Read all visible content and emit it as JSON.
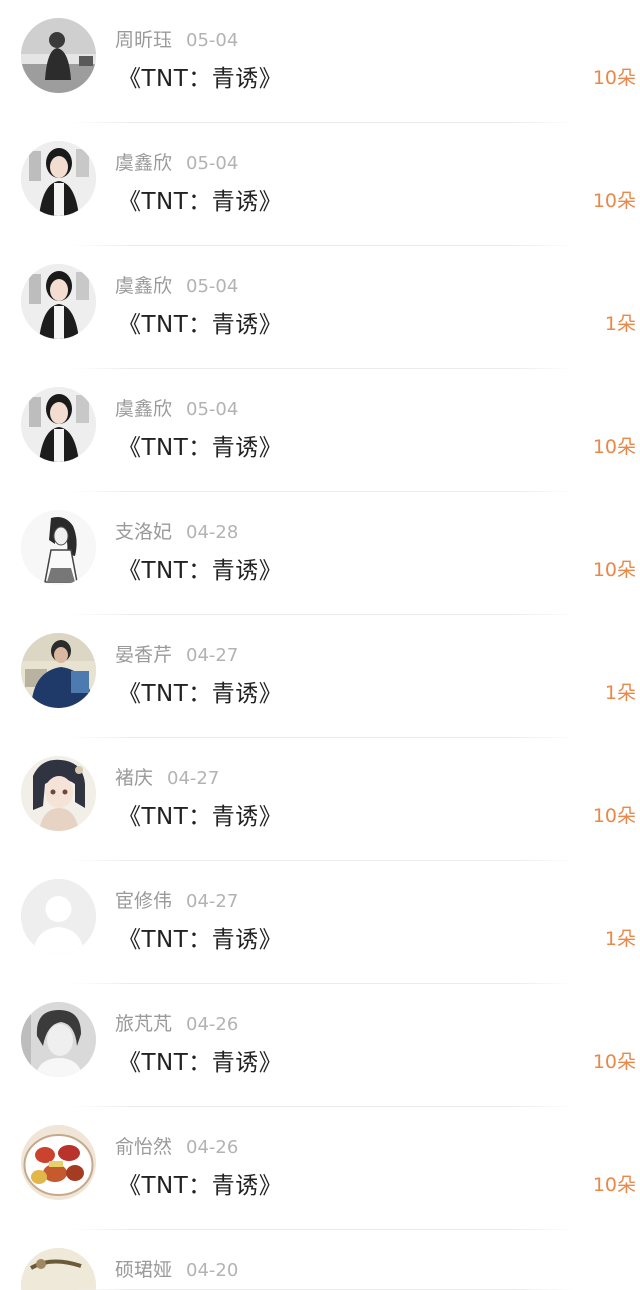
{
  "records": [
    {
      "name": "周昕珏",
      "date": "05-04",
      "gift": "《TNT：青诱》",
      "amount": "10朵",
      "avatar": "avatar-gray-street"
    },
    {
      "name": "虞鑫欣",
      "date": "05-04",
      "gift": "《TNT：青诱》",
      "amount": "10朵",
      "avatar": "avatar-girl-portrait"
    },
    {
      "name": "虞鑫欣",
      "date": "05-04",
      "gift": "《TNT：青诱》",
      "amount": "1朵",
      "avatar": "avatar-girl-portrait"
    },
    {
      "name": "虞鑫欣",
      "date": "05-04",
      "gift": "《TNT：青诱》",
      "amount": "10朵",
      "avatar": "avatar-girl-portrait"
    },
    {
      "name": "支洛妃",
      "date": "04-28",
      "gift": "《TNT：青诱》",
      "amount": "10朵",
      "avatar": "avatar-sketch-girl"
    },
    {
      "name": "晏香芹",
      "date": "04-27",
      "gift": "《TNT：青诱》",
      "amount": "1朵",
      "avatar": "avatar-man-newspaper"
    },
    {
      "name": "褚庆",
      "date": "04-27",
      "gift": "《TNT：青诱》",
      "amount": "10朵",
      "avatar": "avatar-anime-girl"
    },
    {
      "name": "宦修伟",
      "date": "04-27",
      "gift": "《TNT：青诱》",
      "amount": "1朵",
      "avatar": "avatar-default-silhouette"
    },
    {
      "name": "旅芃芃",
      "date": "04-26",
      "gift": "《TNT：青诱》",
      "amount": "10朵",
      "avatar": "avatar-short-hair"
    },
    {
      "name": "俞怡然",
      "date": "04-26",
      "gift": "《TNT：青诱》",
      "amount": "10朵",
      "avatar": "avatar-food"
    },
    {
      "name": "硕珺娅",
      "date": "04-20",
      "avatar": "avatar-partial"
    }
  ],
  "colors": {
    "amount": "#e8884a",
    "name": "#9a9a9a",
    "gift": "#222222"
  }
}
